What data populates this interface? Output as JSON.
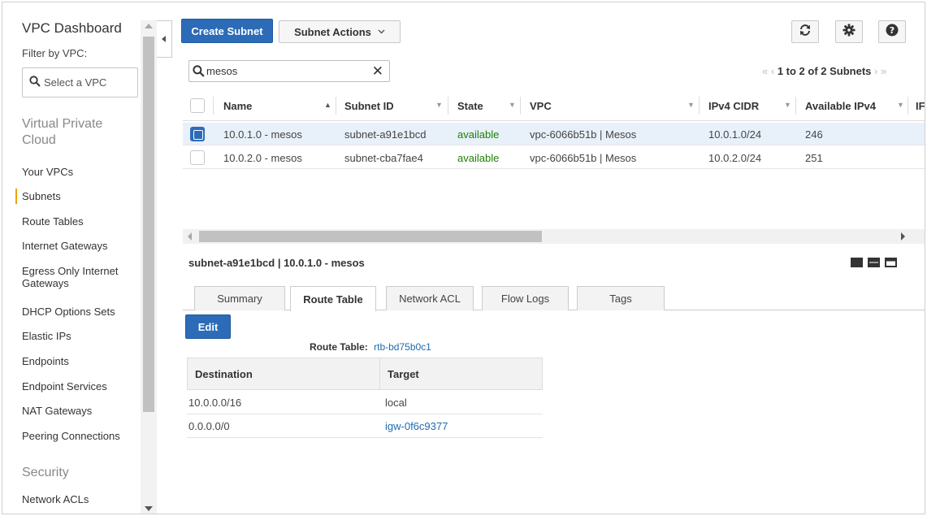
{
  "sidebar": {
    "title": "VPC Dashboard",
    "filter_label": "Filter by VPC:",
    "select_placeholder": "Select a VPC",
    "section_vpc": "Virtual Private Cloud",
    "items": [
      "Your VPCs",
      "Subnets",
      "Route Tables",
      "Internet Gateways",
      "Egress Only Internet Gateways",
      "DHCP Options Sets",
      "Elastic IPs",
      "Endpoints",
      "Endpoint Services",
      "NAT Gateways",
      "Peering Connections"
    ],
    "active_item": "Subnets",
    "section_security": "Security",
    "security_items": [
      "Network ACLs"
    ]
  },
  "toolbar": {
    "create_label": "Create Subnet",
    "actions_label": "Subnet Actions",
    "refresh_icon": "refresh-icon",
    "settings_icon": "gear-icon",
    "help_icon": "help-icon"
  },
  "search": {
    "value": "mesos"
  },
  "pager": {
    "text": "1 to 2 of 2 Subnets"
  },
  "grid": {
    "columns": [
      "Name",
      "Subnet ID",
      "State",
      "VPC",
      "IPv4 CIDR",
      "Available IPv4",
      "IF"
    ],
    "rows": [
      {
        "selected": true,
        "name": "10.0.1.0 - mesos",
        "subnet_id": "subnet-a91e1bcd",
        "state": "available",
        "vpc": "vpc-6066b51b | Mesos",
        "cidr": "10.0.1.0/24",
        "available": "246"
      },
      {
        "selected": false,
        "name": "10.0.2.0 - mesos",
        "subnet_id": "subnet-cba7fae4",
        "state": "available",
        "vpc": "vpc-6066b51b | Mesos",
        "cidr": "10.0.2.0/24",
        "available": "251"
      }
    ]
  },
  "details": {
    "title": "subnet-a91e1bcd | 10.0.1.0 - mesos",
    "tabs": [
      "Summary",
      "Route Table",
      "Network ACL",
      "Flow Logs",
      "Tags"
    ],
    "active_tab": "Route Table",
    "edit_label": "Edit",
    "route_table_label": "Route Table:",
    "route_table_id": "rtb-bd75b0c1",
    "route_columns": [
      "Destination",
      "Target"
    ],
    "routes": [
      {
        "destination": "10.0.0.0/16",
        "target": "local",
        "target_is_link": false
      },
      {
        "destination": "0.0.0.0/0",
        "target": "igw-0f6c9377",
        "target_is_link": true
      }
    ]
  },
  "colors": {
    "primary": "#2c6bb7",
    "link": "#1f6bb0",
    "available": "#1d8102",
    "active_marker": "#f0a000",
    "selected_row": "#e8f0fa"
  }
}
